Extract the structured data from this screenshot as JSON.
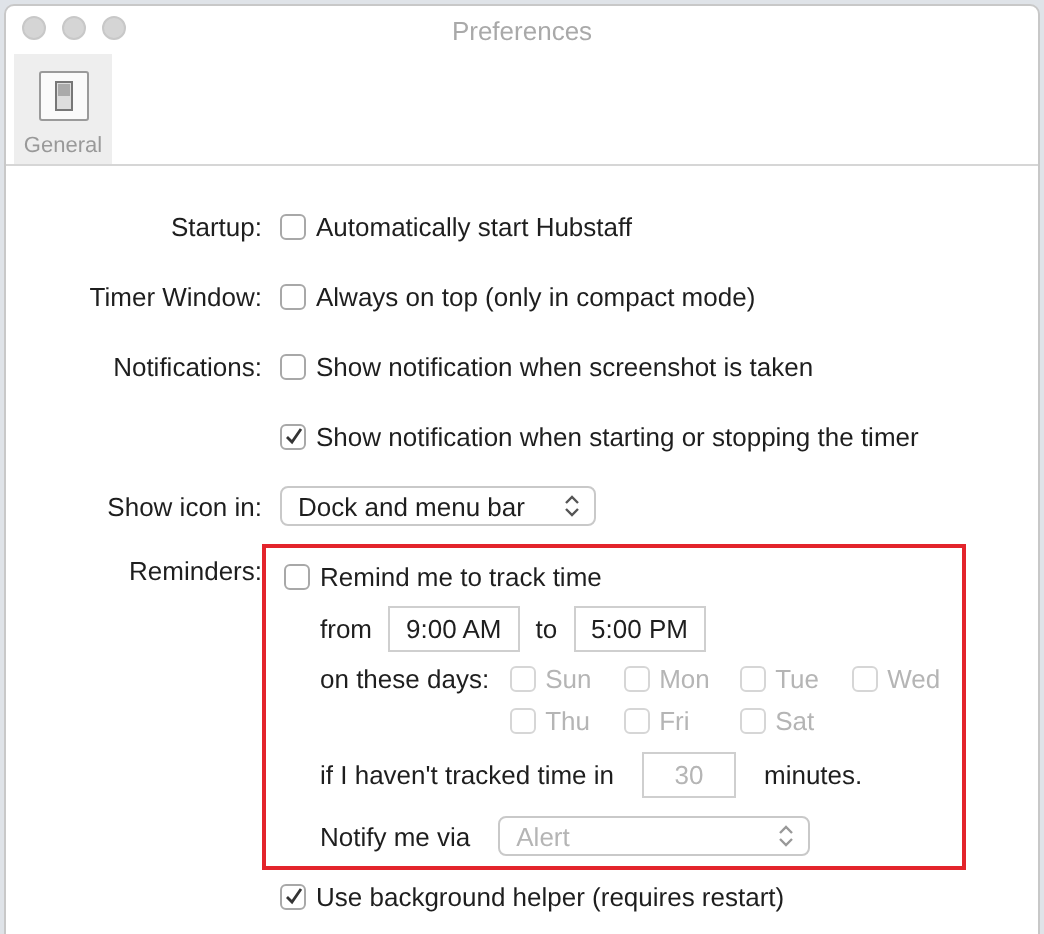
{
  "window": {
    "title": "Preferences"
  },
  "toolbar": {
    "tabs": [
      {
        "label": "General",
        "selected": true
      }
    ]
  },
  "settings": [
    {
      "label": "Startup:",
      "kind": "checkbox",
      "text": "Automatically start Hubstaff",
      "checked": false
    },
    {
      "label": "Timer Window:",
      "kind": "checkbox",
      "text": "Always on top (only in compact mode)",
      "checked": false
    },
    {
      "label": "Notifications:",
      "kind": "checkbox",
      "text": "Show notification when screenshot is taken",
      "checked": false
    },
    {
      "kind": "checkbox",
      "text": "Show notification when starting or stopping the timer",
      "checked": true
    },
    {
      "label": "Show icon in:",
      "kind": "select",
      "value": "Dock and menu bar",
      "disabled": false
    }
  ],
  "reminders": {
    "label": "Reminders:",
    "highlighted": true,
    "text": "Remind me to track time",
    "checked": false,
    "from_label": "from",
    "from": "9:00 AM",
    "to_label": "to",
    "to": "5:00 PM",
    "days_label": "on these days:",
    "days": [
      {
        "name": "Sun",
        "checked": false,
        "disabled": true
      },
      {
        "name": "Mon",
        "checked": false,
        "disabled": true
      },
      {
        "name": "Tue",
        "checked": false,
        "disabled": true
      },
      {
        "name": "Wed",
        "checked": false,
        "disabled": true
      },
      {
        "name": "Thu",
        "checked": false,
        "disabled": true
      },
      {
        "name": "Fri",
        "checked": false,
        "disabled": true
      },
      {
        "name": "Sat",
        "checked": false,
        "disabled": true
      }
    ],
    "interval_before": "if I haven't tracked time in",
    "interval": "30",
    "interval_disabled": true,
    "interval_after": "minutes.",
    "notify_label": "Notify me via",
    "notify": {
      "value": "Alert",
      "disabled": true
    }
  },
  "background_helper": {
    "text": "Use background helper (requires restart)",
    "checked": true
  }
}
